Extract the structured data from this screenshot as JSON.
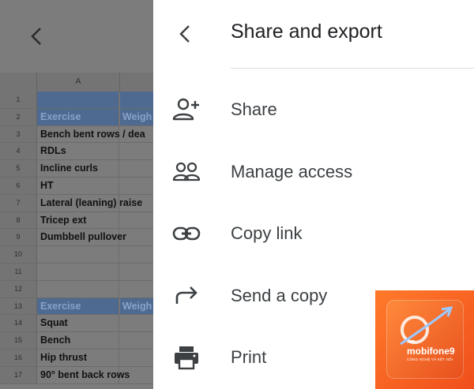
{
  "sheet": {
    "column_header": "A",
    "rows": [
      {
        "num": "1",
        "a": "",
        "b": "",
        "header": true
      },
      {
        "num": "2",
        "a": "Exercise",
        "b": "Weigh",
        "header": true
      },
      {
        "num": "3",
        "a": "Bench bent rows / dea",
        "b": ""
      },
      {
        "num": "4",
        "a": "RDLs",
        "b": ""
      },
      {
        "num": "5",
        "a": "Incline curls",
        "b": ""
      },
      {
        "num": "6",
        "a": "HT",
        "b": ""
      },
      {
        "num": "7",
        "a": "Lateral (leaning) raise",
        "b": ""
      },
      {
        "num": "8",
        "a": "Tricep ext",
        "b": ""
      },
      {
        "num": "9",
        "a": "Dumbbell pullover",
        "b": ""
      },
      {
        "num": "10",
        "a": "",
        "b": ""
      },
      {
        "num": "11",
        "a": "",
        "b": ""
      },
      {
        "num": "12",
        "a": "",
        "b": ""
      },
      {
        "num": "13",
        "a": "Exercise",
        "b": "Weigh",
        "header": true
      },
      {
        "num": "14",
        "a": "Squat",
        "b": ""
      },
      {
        "num": "15",
        "a": "Bench",
        "b": ""
      },
      {
        "num": "16",
        "a": "Hip thrust",
        "b": ""
      },
      {
        "num": "17",
        "a": "90° bent back rows",
        "b": ""
      }
    ]
  },
  "panel": {
    "title": "Share and export",
    "items": [
      {
        "label": "Share",
        "icon": "person-add-icon"
      },
      {
        "label": "Manage access",
        "icon": "people-icon"
      },
      {
        "label": "Copy link",
        "icon": "link-icon"
      },
      {
        "label": "Send a copy",
        "icon": "forward-arrow-icon"
      },
      {
        "label": "Print",
        "icon": "printer-icon"
      }
    ]
  },
  "watermark": {
    "brand": "mobifone9",
    "domain": ".vn",
    "tagline": "CÔNG NGHỆ VÀ KẾT NỐI"
  }
}
